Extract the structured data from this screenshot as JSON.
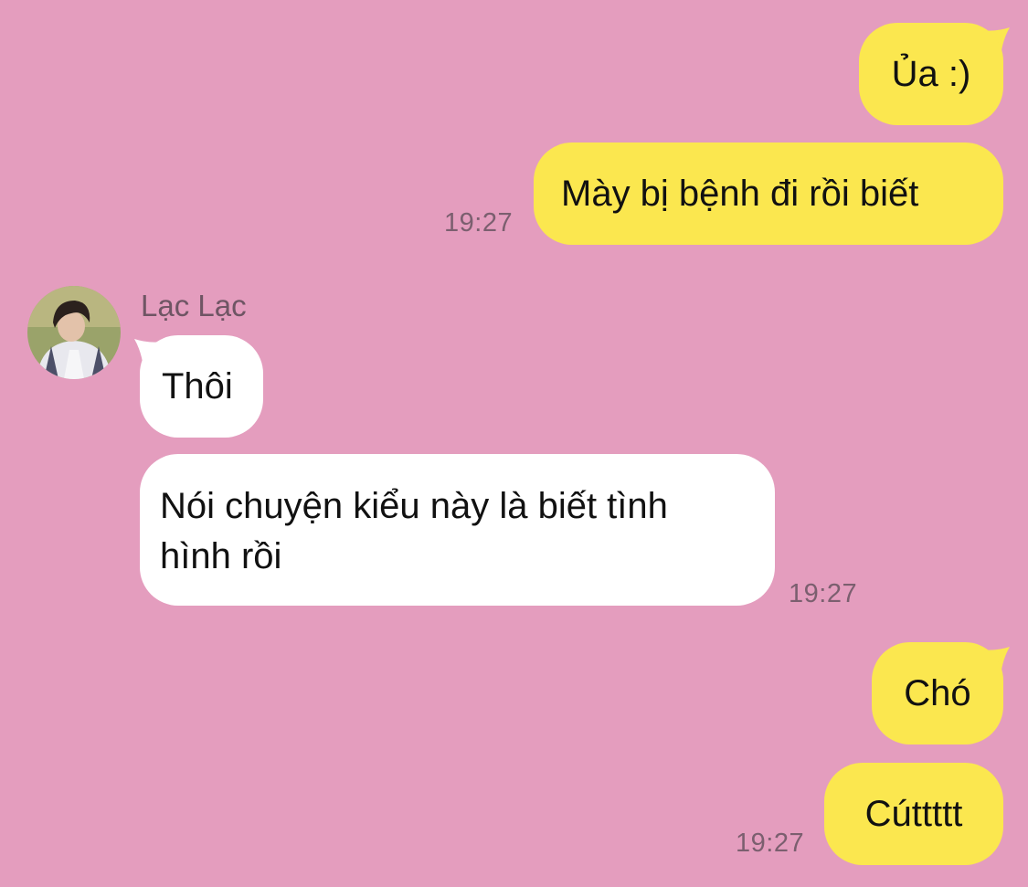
{
  "chat": {
    "colors": {
      "background": "#e49dbe",
      "outgoing_bubble": "#fbe74f",
      "incoming_bubble": "#ffffff",
      "timestamp": "#7b5f6f"
    },
    "messages": [
      {
        "direction": "outgoing",
        "text": "Ủa :)"
      },
      {
        "direction": "outgoing",
        "text": "Mày bị bệnh đi rồi biết",
        "time": "19:27"
      },
      {
        "direction": "incoming",
        "sender": "Lạc Lạc",
        "text": "Thôi"
      },
      {
        "direction": "incoming",
        "text": "Nói chuyện kiểu này là biết tình\nhình rồi",
        "time": "19:27"
      },
      {
        "direction": "outgoing",
        "text": "Chó"
      },
      {
        "direction": "outgoing",
        "text": "Cúttttt",
        "time": "19:27"
      }
    ],
    "contact": {
      "name": "Lạc Lạc",
      "avatar_icon": "profile-photo"
    }
  }
}
